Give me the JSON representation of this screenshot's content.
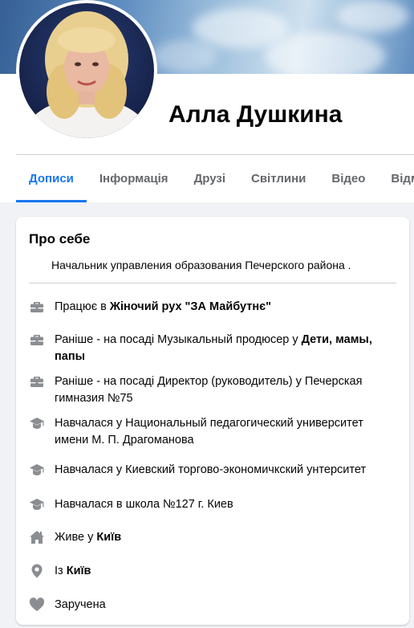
{
  "profile": {
    "name": "Алла Душкина"
  },
  "tabs": [
    {
      "label": "Дописи",
      "active": true
    },
    {
      "label": "Інформація",
      "active": false
    },
    {
      "label": "Друзі",
      "active": false
    },
    {
      "label": "Світлини",
      "active": false
    },
    {
      "label": "Відео",
      "active": false
    },
    {
      "label": "Відмі",
      "active": false
    }
  ],
  "about": {
    "title": "Про себе",
    "bio": "Начальник управления образования Печерского района .",
    "items": [
      {
        "icon": "briefcase-icon",
        "prefix": "Працює в ",
        "bold": "Жіночий рух \"ЗА Майбутнє\"",
        "suffix": ""
      },
      {
        "icon": "briefcase-icon",
        "prefix": "Раніше - на посаді Музыкальный продюсер у ",
        "bold": "Дети, мамы, папы",
        "suffix": ""
      },
      {
        "icon": "briefcase-icon",
        "prefix": "Раніше - на посаді Директор (руководитель) у Печерская гимназия №75",
        "bold": "",
        "suffix": ""
      },
      {
        "icon": "graduation-cap-icon",
        "prefix": "Навчалася у Национальный педагогический университет имени М. П. Драгоманова",
        "bold": "",
        "suffix": ""
      },
      {
        "icon": "graduation-cap-icon",
        "prefix": "Навчалася у Киевский торгово-экономичкский унтерситет",
        "bold": "",
        "suffix": ""
      },
      {
        "icon": "graduation-cap-icon",
        "prefix": "Навчалася в школа №127 г. Киев",
        "bold": "",
        "suffix": ""
      },
      {
        "icon": "home-icon",
        "prefix": "Живе у ",
        "bold": "Київ",
        "suffix": ""
      },
      {
        "icon": "location-pin-icon",
        "prefix": "Із ",
        "bold": "Київ",
        "suffix": ""
      },
      {
        "icon": "heart-icon",
        "prefix": "Заручена",
        "bold": "",
        "suffix": ""
      }
    ]
  },
  "colors": {
    "accent": "#1877f2",
    "icon": "#8a8d91",
    "secondary_text": "#65676b"
  }
}
